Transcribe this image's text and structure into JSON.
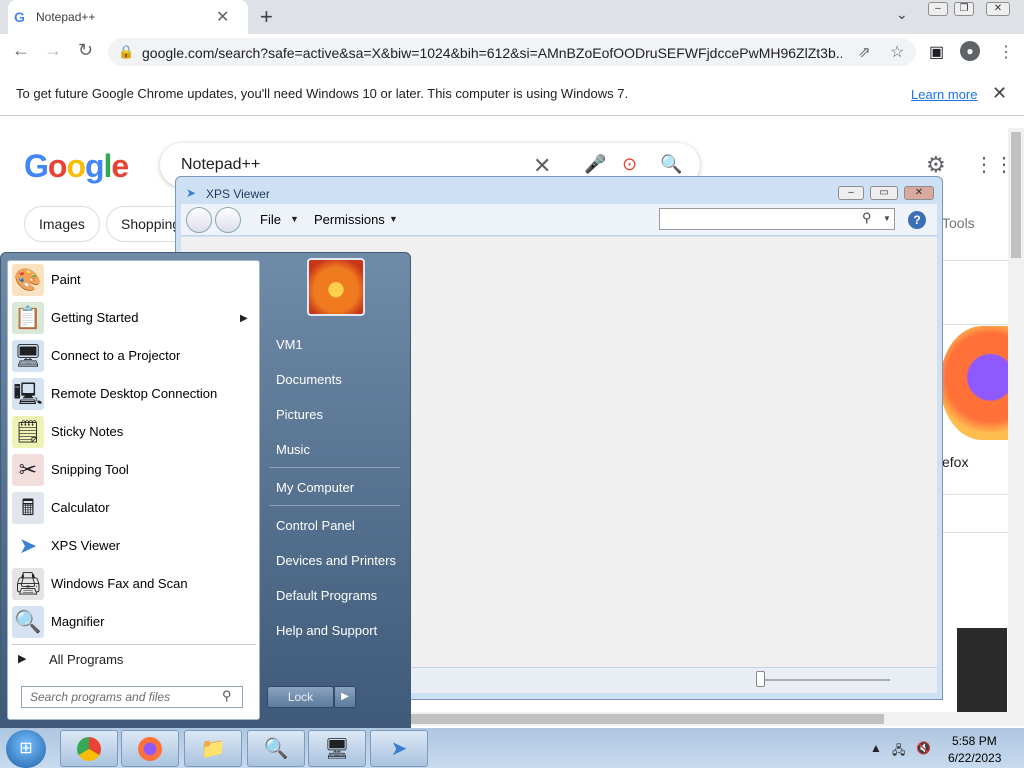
{
  "browser": {
    "tab_title": "Notepad++",
    "tab_favicon": "G",
    "url": "google.com/search?safe=active&sa=X&biw=1024&bih=612&si=AMnBZoEofOODruSEFWFjdccePwMH96ZlZt3b...",
    "infobar_message": "To get future Google Chrome updates, you'll need Windows 10 or later. This computer is using Windows 7.",
    "infobar_link": "Learn more"
  },
  "google": {
    "logo": "Google",
    "query": "Notepad++",
    "chips": [
      "Images",
      "Shopping"
    ],
    "tools_label": "Tools",
    "firefox_text": "efox"
  },
  "xps": {
    "title": "XPS Viewer",
    "menu_file": "File",
    "menu_permissions": "Permissions",
    "help": "?"
  },
  "start_menu": {
    "programs": [
      {
        "label": "Paint",
        "icon": "paint-icon"
      },
      {
        "label": "Getting Started",
        "icon": "getting-started-icon"
      },
      {
        "label": "Connect to a Projector",
        "icon": "projector-icon"
      },
      {
        "label": "Remote Desktop Connection",
        "icon": "remote-desktop-icon"
      },
      {
        "label": "Sticky Notes",
        "icon": "sticky-notes-icon"
      },
      {
        "label": "Snipping Tool",
        "icon": "snipping-tool-icon"
      },
      {
        "label": "Calculator",
        "icon": "calculator-icon"
      },
      {
        "label": "XPS Viewer",
        "icon": "xps-viewer-icon"
      },
      {
        "label": "Windows Fax and Scan",
        "icon": "fax-icon"
      },
      {
        "label": "Magnifier",
        "icon": "magnifier-icon"
      }
    ],
    "all_programs": "All Programs",
    "search_placeholder": "Search programs and files",
    "right_items": [
      "VM1",
      "Documents",
      "Pictures",
      "Music",
      "My Computer",
      "Control Panel",
      "Devices and Printers",
      "Default Programs",
      "Help and Support"
    ],
    "lock_label": "Lock"
  },
  "taskbar": {
    "time": "5:58 PM",
    "date": "6/22/2023"
  }
}
